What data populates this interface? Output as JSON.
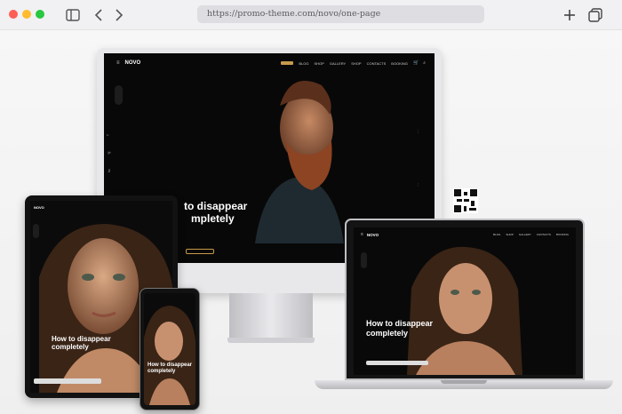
{
  "browser": {
    "url": "https://promo-theme.com/novo/one-page"
  },
  "site": {
    "logo": "NOVO",
    "nav": [
      "BLOG",
      "SHOP",
      "GALLERY",
      "SHOP",
      "CONTACTS",
      "BOOKING"
    ],
    "hero_title_line1": "to disappear",
    "hero_title_line2": "mpletely",
    "device_title_line1": "How to disappear",
    "device_title_line2": "completely"
  },
  "colors": {
    "accent": "#c79b4b",
    "screen_bg": "#080808",
    "chrome_bg": "#f1f1f3"
  },
  "icons": [
    "sidebar-toggle-icon",
    "back-icon",
    "forward-icon",
    "new-tab-icon",
    "tabs-icon",
    "cart-icon",
    "search-icon",
    "qr-code-icon"
  ]
}
